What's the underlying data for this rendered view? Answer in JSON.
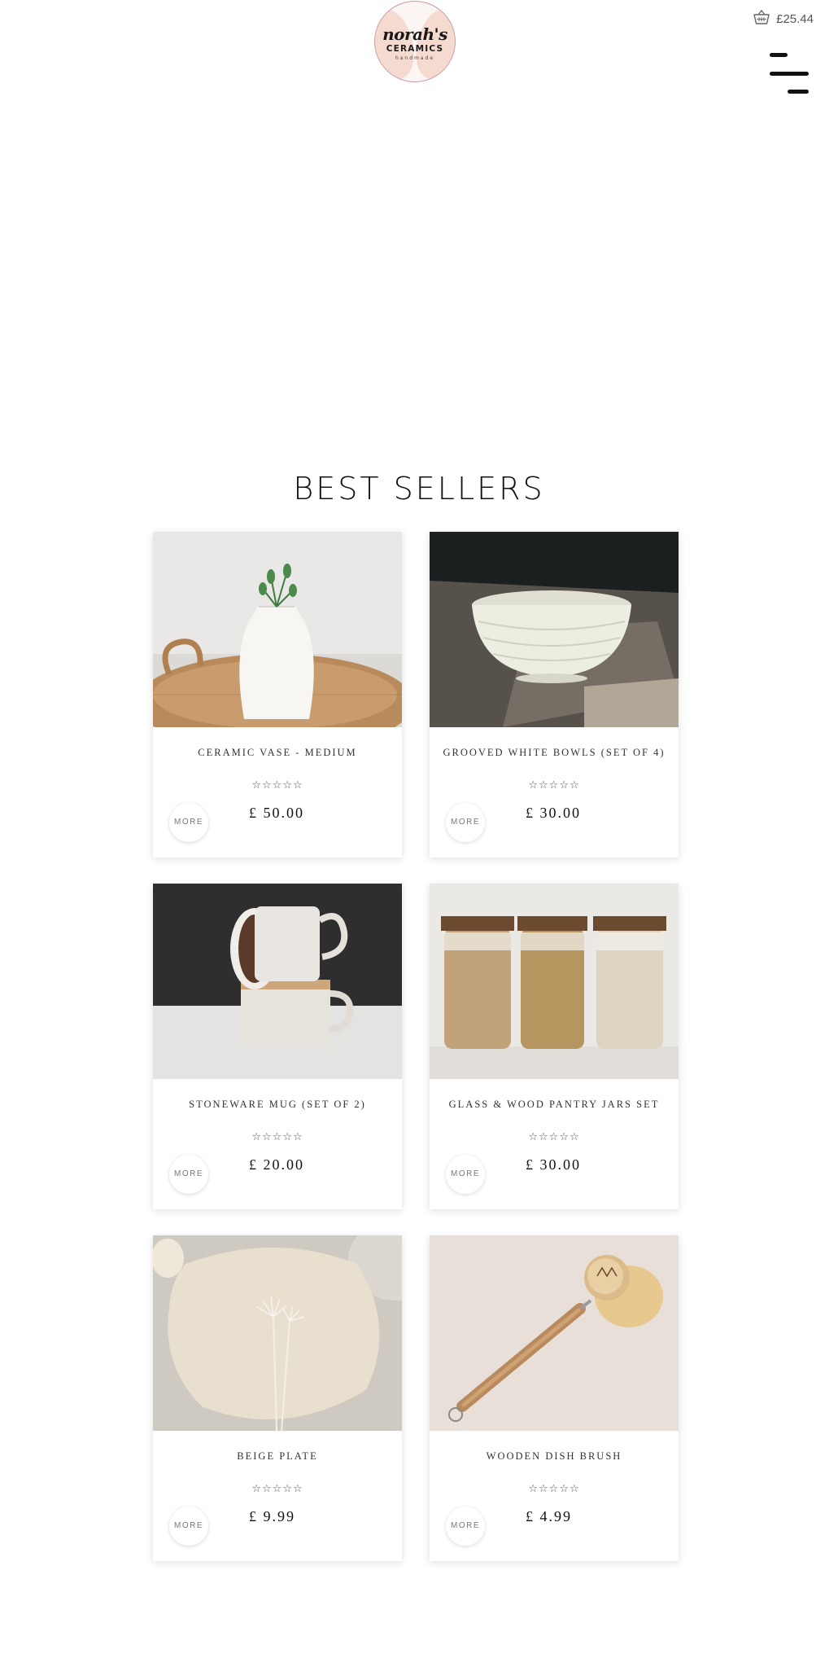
{
  "header": {
    "logo": {
      "script": "norah's",
      "line": "CERAMICS",
      "sub": "handmade"
    },
    "cart_total": "£25.44"
  },
  "section_title": "BEST SELLERS",
  "products": [
    {
      "name": "CERAMIC VASE - MEDIUM",
      "price": "£ 50.00",
      "stars": "☆☆☆☆☆",
      "more": "MORE"
    },
    {
      "name": "GROOVED WHITE BOWLS (SET OF 4)",
      "price": "£ 30.00",
      "stars": "☆☆☆☆☆",
      "more": "MORE"
    },
    {
      "name": "STONEWARE MUG (SET OF 2)",
      "price": "£ 20.00",
      "stars": "☆☆☆☆☆",
      "more": "MORE"
    },
    {
      "name": "GLASS & WOOD PANTRY JARS SET",
      "price": "£ 30.00",
      "stars": "☆☆☆☆☆",
      "more": "MORE"
    },
    {
      "name": "BEIGE PLATE",
      "price": "£ 9.99",
      "stars": "☆☆☆☆☆",
      "more": "MORE"
    },
    {
      "name": "WOODEN DISH BRUSH",
      "price": "£ 4.99",
      "stars": "☆☆☆☆☆",
      "more": "MORE"
    }
  ],
  "icons": {
    "cart": "basket-icon",
    "menu": "hamburger-menu-icon"
  },
  "colors": {
    "logo_ring": "#c99aa3",
    "logo_brush": "#f3d6c8",
    "text": "#111111"
  }
}
